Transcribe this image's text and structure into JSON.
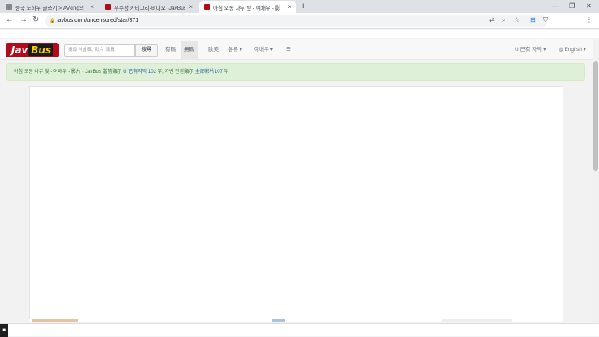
{
  "browser": {
    "tabs": [
      {
        "title": "중국 노하우 글쓰기 > AVking의",
        "favicon_color": "#888888",
        "active": false
      },
      {
        "title": "무수정 카테고리-비디오 -JavBus",
        "favicon_color": "#b20b1c",
        "active": false
      },
      {
        "title": "아침 오동 나무 빛 - 여배우 - 影",
        "favicon_color": "#b20b1c",
        "active": true
      }
    ],
    "new_tab": "+",
    "close_glyph": "×",
    "url": "javbus.com/uncensored/star/371"
  },
  "site": {
    "logo_left": "Jav",
    "logo_right": "Bus",
    "search_placeholder": "搜尋 식별 碼, 影片, 演員",
    "search_button": "搜尋",
    "menu": [
      "有碼",
      "無碼",
      "歐美",
      "분류 ▾",
      "여배우 ▾",
      "☰"
    ],
    "active_menu_index": 1,
    "lang_menu": "U 已有 자막 ▾",
    "lang_select": "English ▾",
    "alert_text": "아침 오동 나무 빛 - 여배우 - 影片 - JavBus   當前顯示",
    "alert_badge": "U 已有자막 102",
    "alert_mid": "부, 가변 전환顯示",
    "alert_badge2": "全部影片107",
    "alert_tail": "부"
  }
}
